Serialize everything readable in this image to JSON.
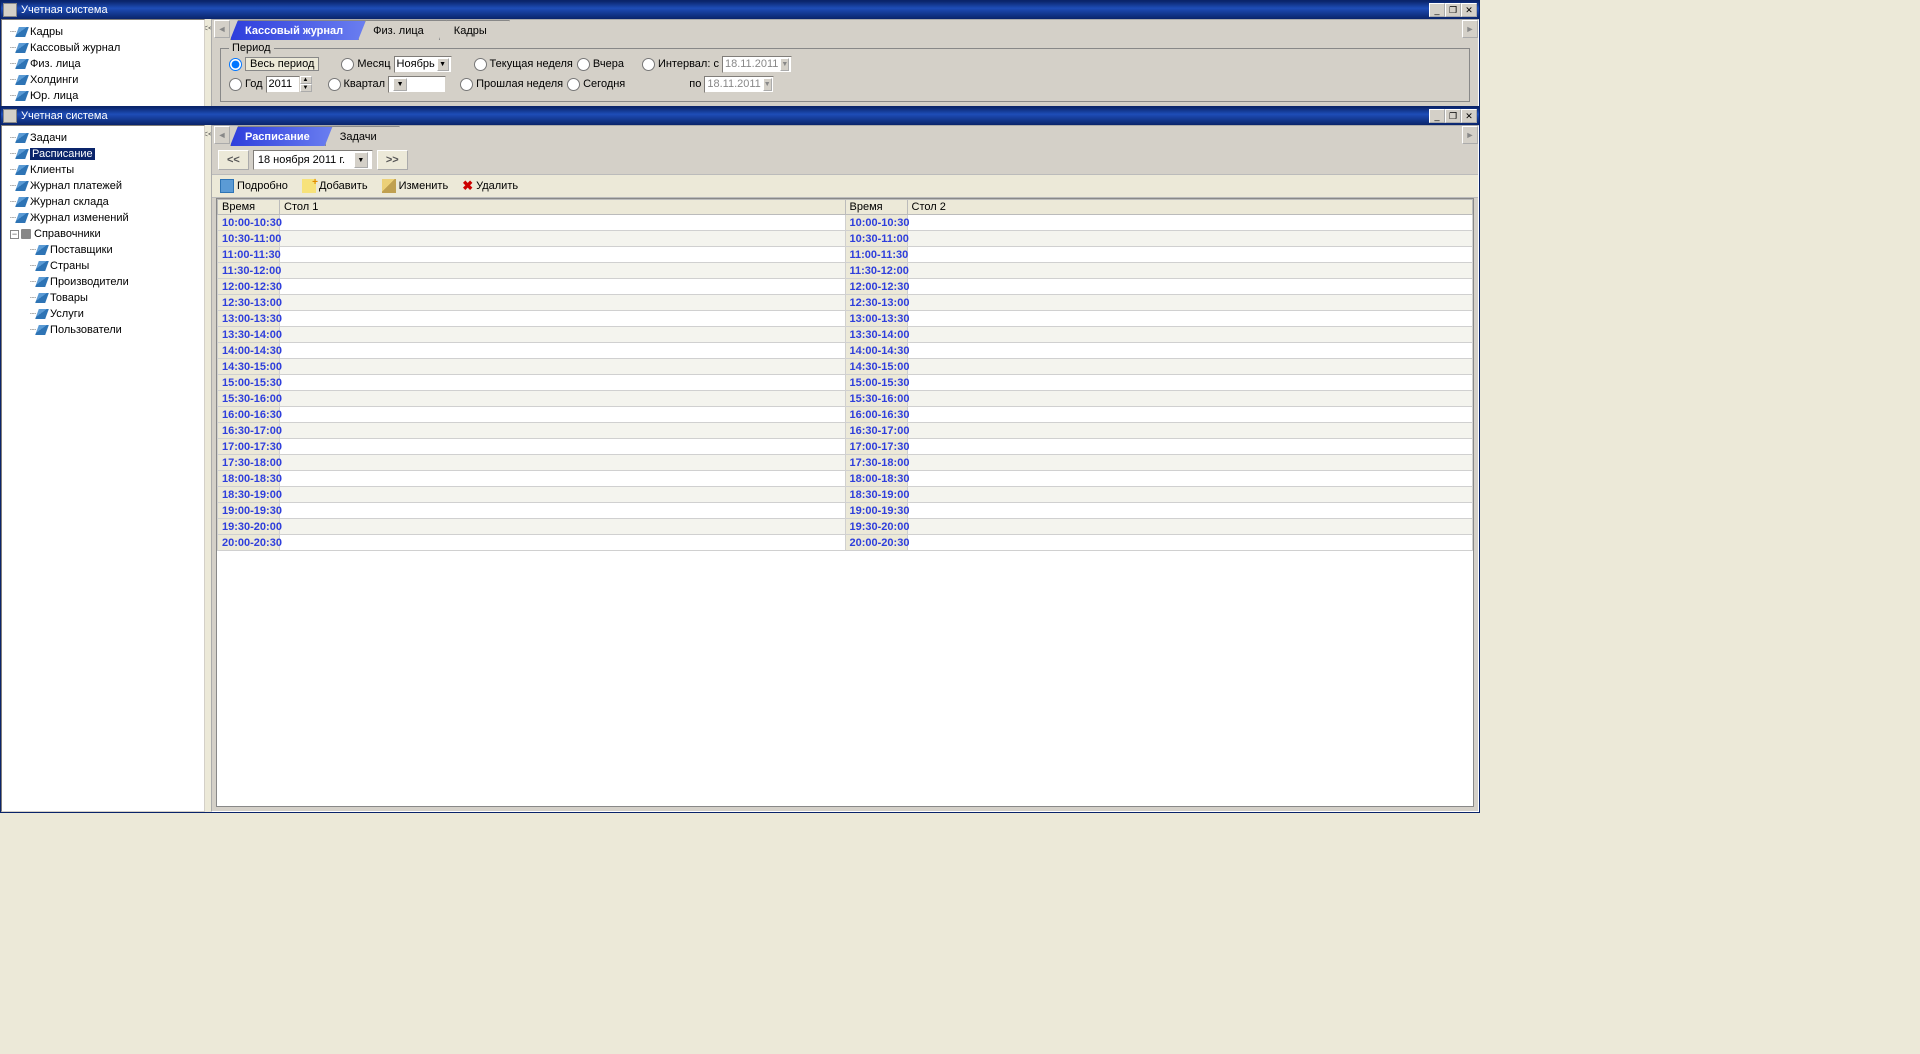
{
  "win1": {
    "title": "Учетная система",
    "tree": [
      "Кадры",
      "Кассовый журнал",
      "Физ. лица",
      "Холдинги",
      "Юр. лица"
    ],
    "tabs": [
      {
        "label": "Кассовый журнал",
        "active": true
      },
      {
        "label": "Физ. лица",
        "active": false
      },
      {
        "label": "Кадры",
        "active": false
      }
    ],
    "period": {
      "legend": "Период",
      "all_period": "Весь период",
      "year": "Год",
      "year_val": "2011",
      "month": "Месяц",
      "month_val": "Ноябрь",
      "quarter": "Квартал",
      "quarter_val": "",
      "cur_week": "Текущая неделя",
      "prev_week": "Прошлая неделя",
      "yesterday": "Вчера",
      "today": "Сегодня",
      "interval": "Интервал: с",
      "interval_to": "по",
      "date_from": "18.11.2011",
      "date_to": "18.11.2011"
    }
  },
  "win2": {
    "title": "Учетная система",
    "tree_top": [
      "Задачи",
      "Расписание",
      "Клиенты",
      "Журнал платежей",
      "Журнал склада",
      "Журнал изменений"
    ],
    "tree_selected": "Расписание",
    "tree_ref_label": "Справочники",
    "tree_ref_children": [
      "Поставщики",
      "Страны",
      "Производители",
      "Товары",
      "Услуги",
      "Пользователи"
    ],
    "tabs": [
      {
        "label": "Расписание",
        "active": true
      },
      {
        "label": "Задачи",
        "active": false
      }
    ],
    "date_nav": "18   ноября   2011 г.",
    "toolbar": {
      "detail": "Подробно",
      "add": "Добавить",
      "edit": "Изменить",
      "delete": "Удалить"
    },
    "cols": {
      "time": "Время",
      "stol1": "Стол 1",
      "stol2": "Стол 2"
    },
    "slots": [
      "10:00-10:30",
      "10:30-11:00",
      "11:00-11:30",
      "11:30-12:00",
      "12:00-12:30",
      "12:30-13:00",
      "13:00-13:30",
      "13:30-14:00",
      "14:00-14:30",
      "14:30-15:00",
      "15:00-15:30",
      "15:30-16:00",
      "16:00-16:30",
      "16:30-17:00",
      "17:00-17:30",
      "17:30-18:00",
      "18:00-18:30",
      "18:30-19:00",
      "19:00-19:30",
      "19:30-20:00",
      "20:00-20:30"
    ]
  }
}
